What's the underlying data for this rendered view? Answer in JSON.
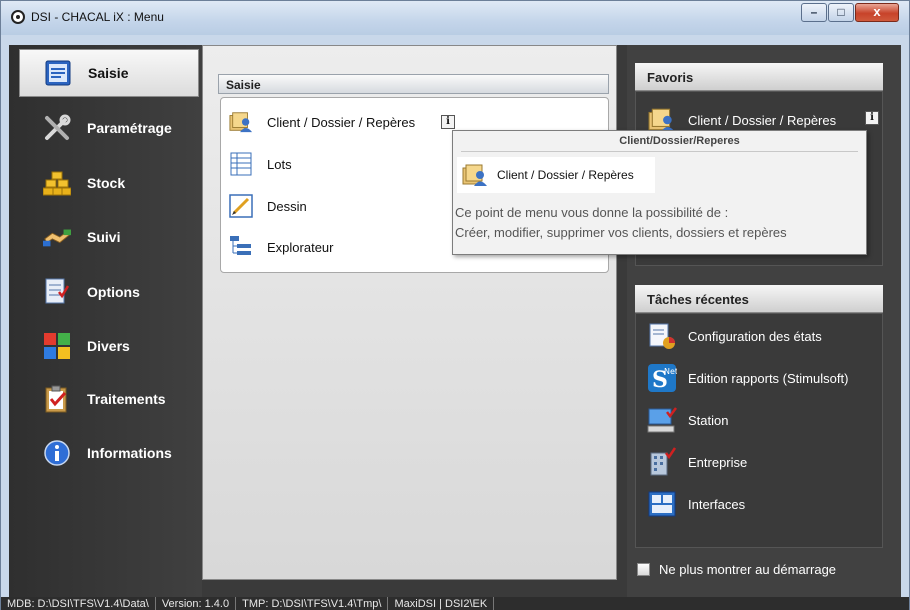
{
  "window": {
    "title": "DSI - CHACAL iX : Menu",
    "buttons": {
      "minimize": "–",
      "maximize": "□",
      "close": "x"
    }
  },
  "nav": {
    "items": [
      {
        "label": "Saisie",
        "icon": "form-icon"
      },
      {
        "label": "Paramétrage",
        "icon": "tools-icon"
      },
      {
        "label": "Stock",
        "icon": "gold-bars-icon"
      },
      {
        "label": "Suivi",
        "icon": "handshake-icon"
      },
      {
        "label": "Options",
        "icon": "options-icon"
      },
      {
        "label": "Divers",
        "icon": "colored-squares-icon"
      },
      {
        "label": "Traitements",
        "icon": "clipboard-icon"
      },
      {
        "label": "Informations",
        "icon": "info-icon"
      }
    ]
  },
  "center": {
    "section_title": "Saisie",
    "items": [
      {
        "label": "Client / Dossier / Repères",
        "icon": "client-folder-icon",
        "info": "i"
      },
      {
        "label": "Lots",
        "icon": "list-icon"
      },
      {
        "label": "Dessin",
        "icon": "drawing-icon"
      },
      {
        "label": "Explorateur",
        "icon": "tree-icon"
      }
    ]
  },
  "tooltip": {
    "title": "Client/Dossier/Reperes",
    "item_label": "Client / Dossier / Repères",
    "desc_line1": "Ce point de menu vous donne la possibilité de :",
    "desc_line2": "Créer, modifier, supprimer vos clients, dossiers et repères"
  },
  "favoris": {
    "title": "Favoris",
    "items": [
      {
        "label": "Client / Dossier / Repères",
        "icon": "client-folder-icon",
        "info": "i"
      }
    ]
  },
  "recent": {
    "title": "Tâches récentes",
    "items": [
      {
        "label": "Configuration des états",
        "icon": "report-config-icon"
      },
      {
        "label": "Edition rapports (Stimulsoft)",
        "icon": "stimulsoft-icon"
      },
      {
        "label": "Station",
        "icon": "station-icon"
      },
      {
        "label": "Entreprise",
        "icon": "building-icon"
      },
      {
        "label": "Interfaces",
        "icon": "interfaces-icon"
      }
    ]
  },
  "startup_checkbox": {
    "label": "Ne plus montrer au démarrage",
    "checked": false
  },
  "statusbar": {
    "mdb": "MDB: D:\\DSI\\TFS\\V1.4\\Data\\",
    "version": "Version: 1.4.0",
    "tmp": "TMP: D:\\DSI\\TFS\\V1.4\\Tmp\\",
    "server": "MaxiDSI | DSI2\\EK"
  }
}
